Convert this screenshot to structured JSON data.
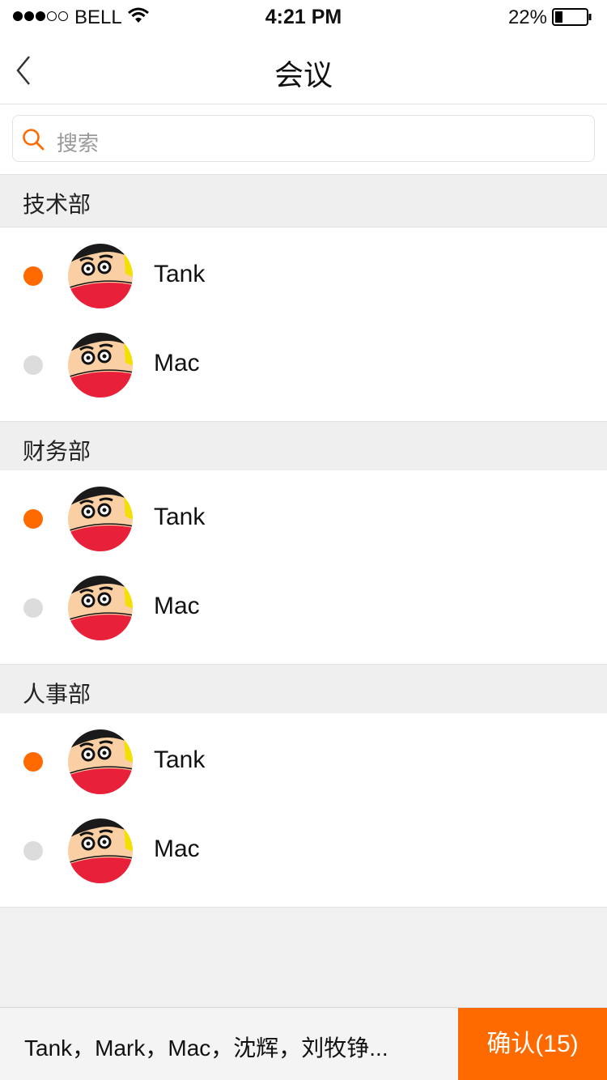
{
  "status_bar": {
    "carrier": "BELL",
    "time": "4:21 PM",
    "battery": "22%"
  },
  "nav": {
    "title": "会议",
    "back_icon": "chevron-left-icon"
  },
  "search": {
    "placeholder": "搜索",
    "icon": "search-icon"
  },
  "colors": {
    "accent": "#ff6a00",
    "unselected": "#dcdcdc"
  },
  "sections": [
    {
      "title": "技术部",
      "members": [
        {
          "name": "Tank",
          "selected": true
        },
        {
          "name": "Mac",
          "selected": false
        }
      ]
    },
    {
      "title": "财务部",
      "members": [
        {
          "name": "Tank",
          "selected": true
        },
        {
          "name": "Mac",
          "selected": false
        }
      ]
    },
    {
      "title": "人事部",
      "members": [
        {
          "name": "Tank",
          "selected": true
        },
        {
          "name": "Mac",
          "selected": false
        }
      ]
    }
  ],
  "bottom": {
    "selected_names": "Tank，Mark，Mac，沈辉，刘牧铮...",
    "confirm_label": "确认(15)"
  }
}
